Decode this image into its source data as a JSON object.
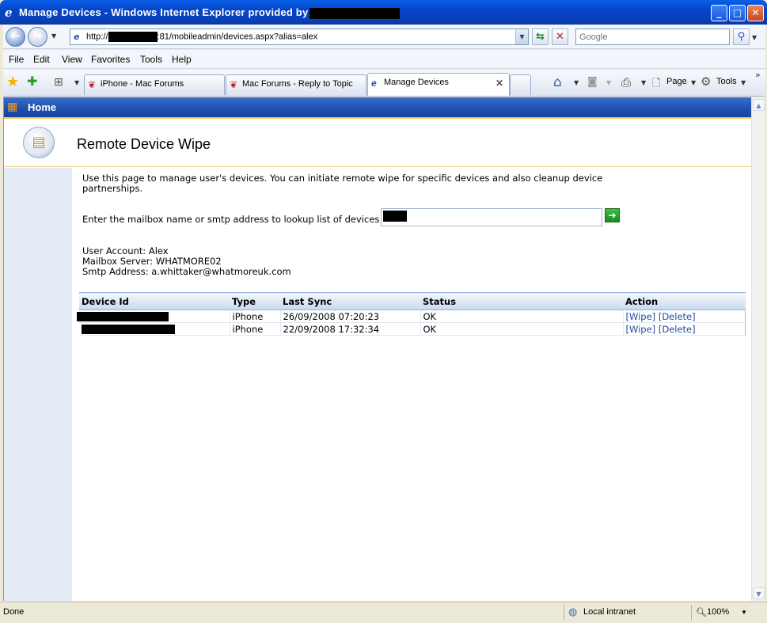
{
  "window": {
    "title": "Manage Devices - Windows Internet Explorer provided by"
  },
  "address": {
    "url_prefix": "http://",
    "url_suffix": ":81/mobileadmin/devices.aspx?alias=alex",
    "search_placeholder": "Google"
  },
  "menu": [
    "File",
    "Edit",
    "View",
    "Favorites",
    "Tools",
    "Help"
  ],
  "tabs": [
    {
      "label": "iPhone - Mac Forums"
    },
    {
      "label": "Mac Forums - Reply to Topic"
    },
    {
      "label": "Manage Devices"
    }
  ],
  "commands": {
    "page": "Page",
    "tools": "Tools"
  },
  "page": {
    "home_label": "Home",
    "title": "Remote Device Wipe",
    "intro": "Use this page to manage user's devices. You can initiate remote wipe for specific devices and also cleanup device partnerships.",
    "lookup_label": "Enter the mailbox name or smtp address to lookup list of devices",
    "user_account": "User Account: Alex",
    "mailbox_server": "Mailbox Server: WHATMORE02",
    "smtp_address": "Smtp Address: a.whittaker@whatmoreuk.com",
    "table": {
      "headers": [
        "Device Id",
        "Type",
        "Last Sync",
        "Status",
        "Action"
      ],
      "rows": [
        {
          "type": "iPhone",
          "last_sync": "26/09/2008 07:20:23",
          "status": "OK",
          "wipe": "[Wipe]",
          "delete": "[Delete]"
        },
        {
          "type": "iPhone",
          "last_sync": "22/09/2008 17:32:34",
          "status": "OK",
          "wipe": "[Wipe]",
          "delete": "[Delete]"
        }
      ]
    }
  },
  "status": {
    "left": "Done",
    "zone": "Local intranet",
    "zoom": "100%"
  },
  "colors": {
    "titlebar": "#0545c8",
    "homebar": "#1d4fae",
    "leftpanel": "#e3ebf7",
    "link": "#1f4c9e"
  }
}
